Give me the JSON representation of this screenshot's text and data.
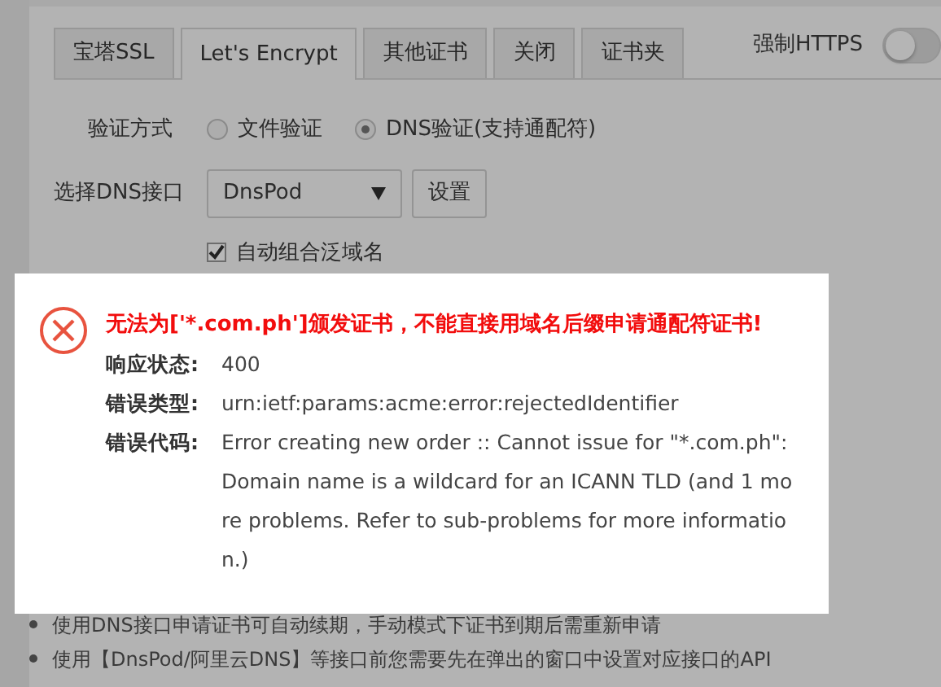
{
  "tabs": [
    {
      "label": "宝塔SSL",
      "selected": false
    },
    {
      "label": "Let's Encrypt",
      "selected": true
    },
    {
      "label": "其他证书",
      "selected": false
    },
    {
      "label": "关闭",
      "selected": false
    },
    {
      "label": "证书夹",
      "selected": false
    }
  ],
  "force_https": {
    "label": "强制HTTPS",
    "on": false
  },
  "verify": {
    "label": "验证方式",
    "options": [
      {
        "label": "文件验证",
        "selected": false
      },
      {
        "label": "DNS验证(支持通配符)",
        "selected": true
      }
    ]
  },
  "dns": {
    "label": "选择DNS接口",
    "value": "DnsPod",
    "button": "设置"
  },
  "auto_wildcard": {
    "label": "自动组合泛域名",
    "checked": true
  },
  "notes": [
    "使用DNS接口申请证书可自动续期，手动模式下证书到期后需重新申请",
    "使用【DnsPod/阿里云DNS】等接口前您需要先在弹出的窗口中设置对应接口的API"
  ],
  "dialog": {
    "title": "无法为['*.com.ph']颁发证书，不能直接用域名后缀申请通配符证书!",
    "fields": [
      {
        "label": "响应状态:",
        "value": "400"
      },
      {
        "label": "错误类型:",
        "value": "urn:ietf:params:acme:error:rejectedIdentifier"
      },
      {
        "label": "错误代码:",
        "value": "Error creating new order :: Cannot issue for \"*.com.ph\": Domain name is a wildcard for an ICANN TLD (and 1 more problems. Refer to sub-problems for more information.)"
      }
    ]
  }
}
